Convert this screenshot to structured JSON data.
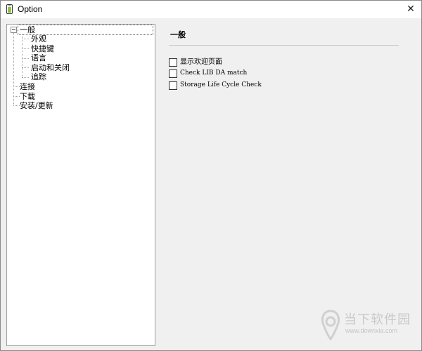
{
  "window": {
    "title": "Option",
    "close_label": "✕"
  },
  "tree": {
    "items": [
      {
        "label": "一般",
        "level": 0,
        "expanded": true,
        "selected": true
      },
      {
        "label": "外观",
        "level": 1
      },
      {
        "label": "快捷键",
        "level": 1
      },
      {
        "label": "语言",
        "level": 1
      },
      {
        "label": "启动和关闭",
        "level": 1
      },
      {
        "label": "追踪",
        "level": 1
      },
      {
        "label": "连接",
        "level": 0
      },
      {
        "label": "下载",
        "level": 0
      },
      {
        "label": "安装/更新",
        "level": 0
      }
    ]
  },
  "panel": {
    "title": "一般",
    "options": [
      {
        "label": "显示欢迎页面",
        "checked": false
      },
      {
        "label": "Check LIB DA match",
        "checked": false
      },
      {
        "label": "Storage Life Cycle Check",
        "checked": false
      }
    ]
  },
  "watermark": {
    "text": "当下软件园",
    "url": "www.downxia.com"
  },
  "colors": {
    "background": "#f0f0f0",
    "tree_background": "#ffffff",
    "app_icon": "#8bc34a"
  }
}
